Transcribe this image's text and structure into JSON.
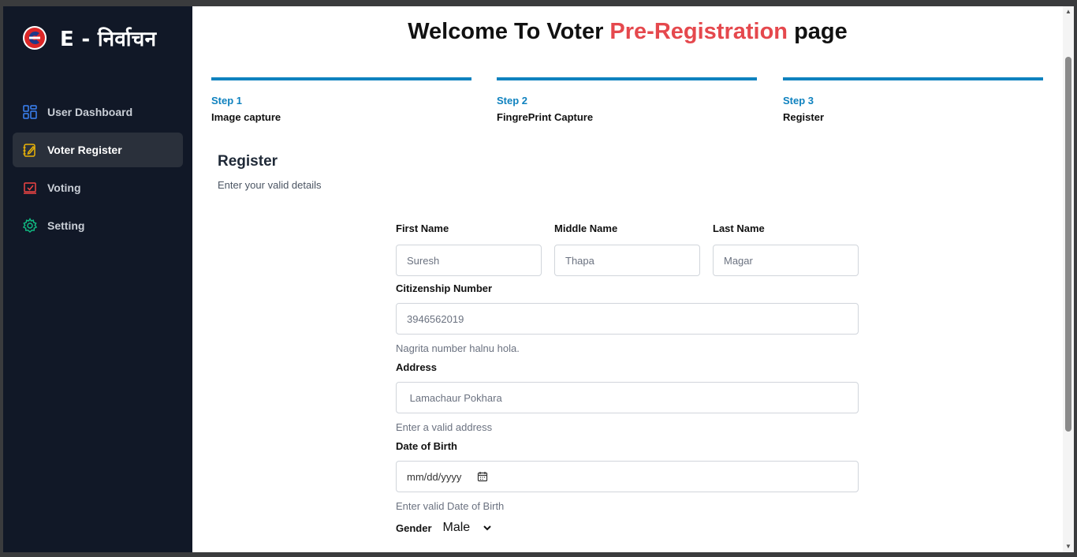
{
  "sidebar": {
    "brand_title": "E - निर्वाचन",
    "items": [
      {
        "label": "User Dashboard",
        "icon": "dashboard-grid-icon",
        "color": "#3b82f6"
      },
      {
        "label": "Voter Register",
        "icon": "edit-notebook-icon",
        "color": "#eab308",
        "active": true
      },
      {
        "label": "Voting",
        "icon": "voting-check-icon",
        "color": "#ef4444"
      },
      {
        "label": "Setting",
        "icon": "gear-icon",
        "color": "#10b981"
      }
    ]
  },
  "header": {
    "title_part1": "Welcome To Voter ",
    "title_accent": "Pre-Registration",
    "title_part2": " page",
    "accent_color": "#e5484d"
  },
  "steps": [
    {
      "number": "Step 1",
      "name": "Image capture"
    },
    {
      "number": "Step 2",
      "name": "FingrePrint Capture"
    },
    {
      "number": "Step 3",
      "name": "Register"
    }
  ],
  "section": {
    "title": "Register",
    "subtitle": "Enter your valid details"
  },
  "form": {
    "first_name": {
      "label": "First Name",
      "placeholder": "Suresh"
    },
    "middle_name": {
      "label": "Middle Name",
      "placeholder": "Thapa"
    },
    "last_name": {
      "label": "Last Name",
      "placeholder": "Magar"
    },
    "citizenship": {
      "label": "Citizenship Number",
      "placeholder": "3946562019",
      "help": "Nagrita number halnu hola."
    },
    "address": {
      "label": "Address",
      "placeholder": " Lamachaur Pokhara",
      "help": "Enter a valid address"
    },
    "dob": {
      "label": "Date of Birth",
      "placeholder": "mm/dd/yyyy",
      "help": "Enter valid Date of Birth"
    },
    "gender": {
      "label": "Gender",
      "value": "Male"
    }
  },
  "theme": {
    "sidebar_bg": "#111827",
    "step_color": "#0f82bf"
  }
}
